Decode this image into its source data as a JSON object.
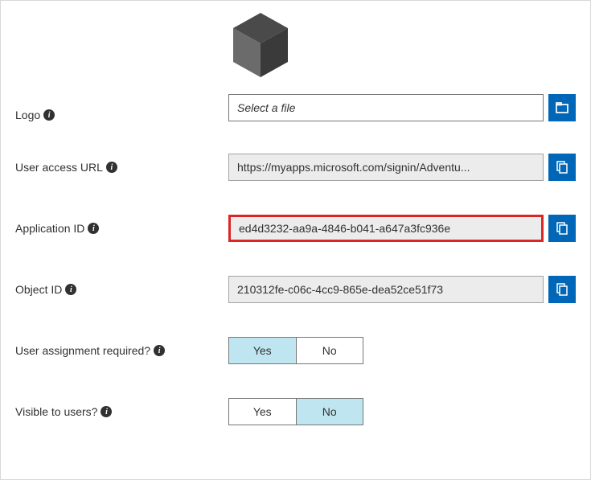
{
  "labels": {
    "logo": "Logo",
    "user_access_url": "User access URL",
    "application_id": "Application ID",
    "object_id": "Object ID",
    "user_assignment_required": "User assignment required?",
    "visible_to_users": "Visible to users?"
  },
  "values": {
    "file_placeholder": "Select a file",
    "user_access_url": "https://myapps.microsoft.com/signin/Adventu...",
    "application_id": "ed4d3232-aa9a-4846-b041-a647a3fc936e",
    "object_id": "210312fe-c06c-4cc9-865e-dea52ce51f73"
  },
  "toggles": {
    "yes": "Yes",
    "no": "No",
    "user_assignment_required": "Yes",
    "visible_to_users": "No"
  },
  "colors": {
    "accent": "#0066b8",
    "highlight_border": "#dc2626",
    "toggle_selected": "#bfe6f0"
  }
}
